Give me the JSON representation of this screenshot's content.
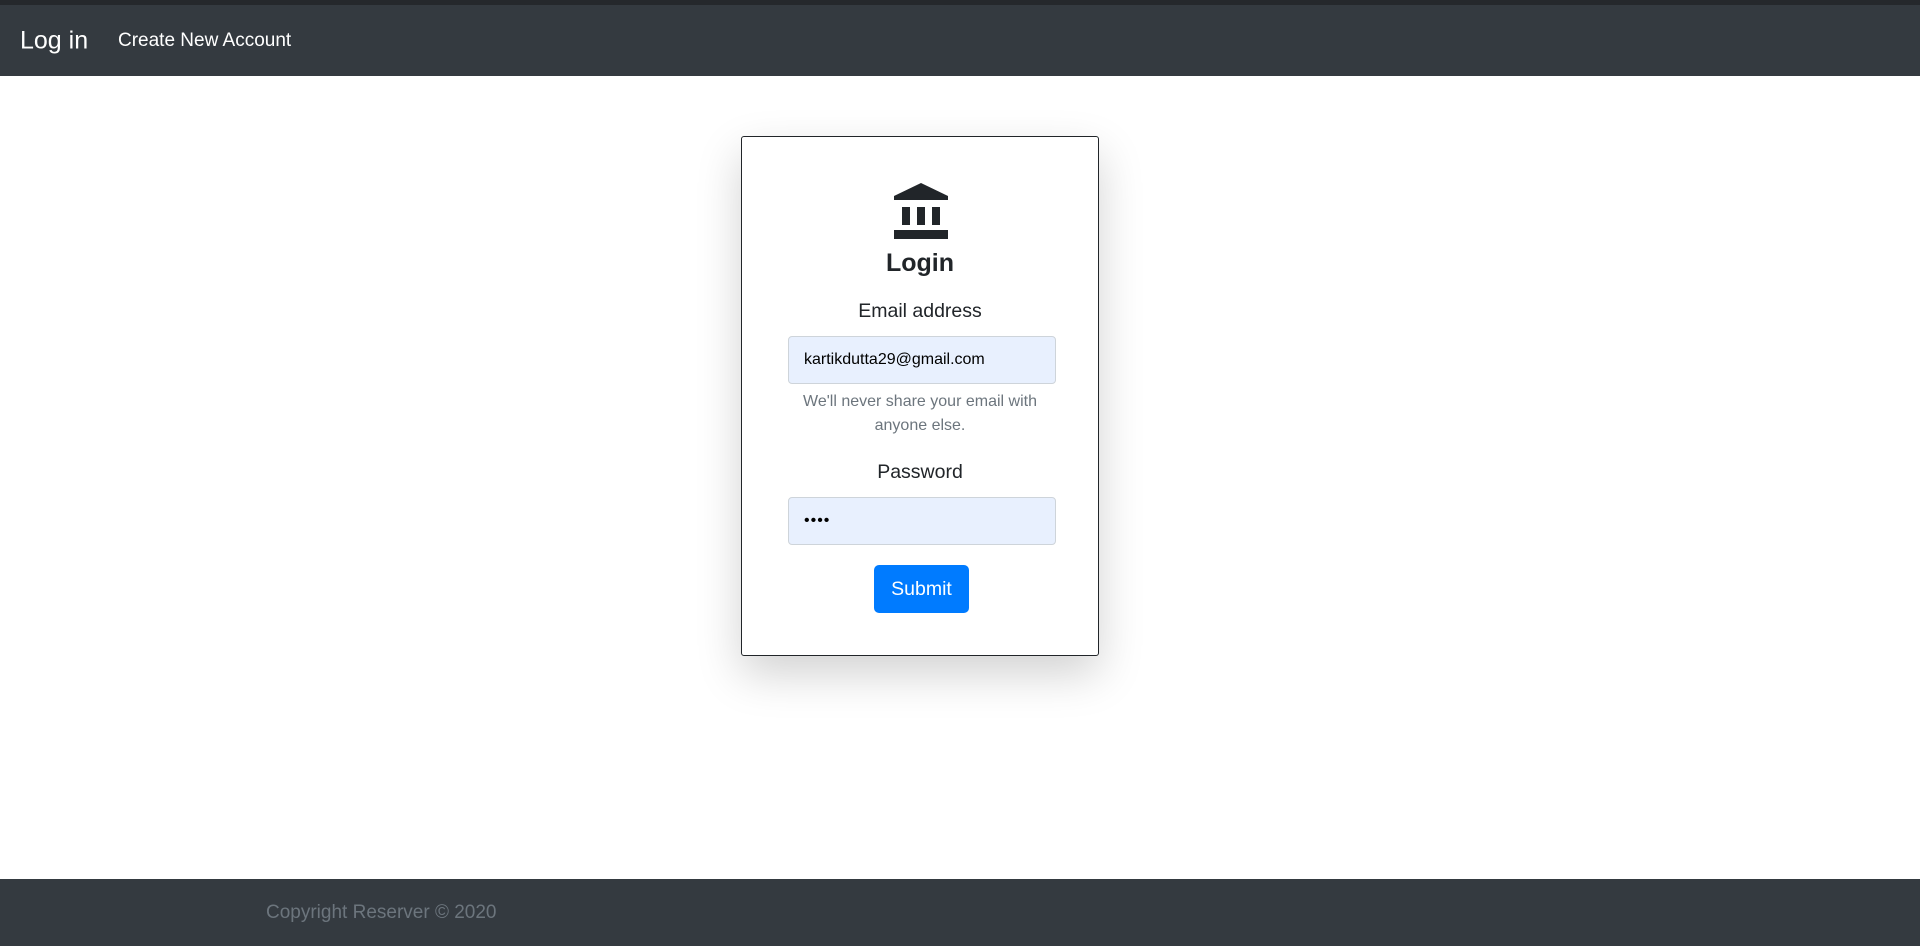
{
  "navbar": {
    "brand": "Log in",
    "links": [
      {
        "label": "Create New Account"
      }
    ]
  },
  "login_card": {
    "icon": "bank-icon",
    "title": "Login",
    "email": {
      "label": "Email address",
      "value": "kartikdutta29@gmail.com",
      "help": "We'll never share your email with anyone else."
    },
    "password": {
      "label": "Password",
      "value": "••••"
    },
    "submit_label": "Submit"
  },
  "footer": {
    "copyright": "Copyright Reserver © 2020"
  },
  "colors": {
    "navbar_bg": "#343a40",
    "primary": "#007bff",
    "autofill_bg": "#e8f0fe",
    "muted_text": "#6c757d"
  }
}
